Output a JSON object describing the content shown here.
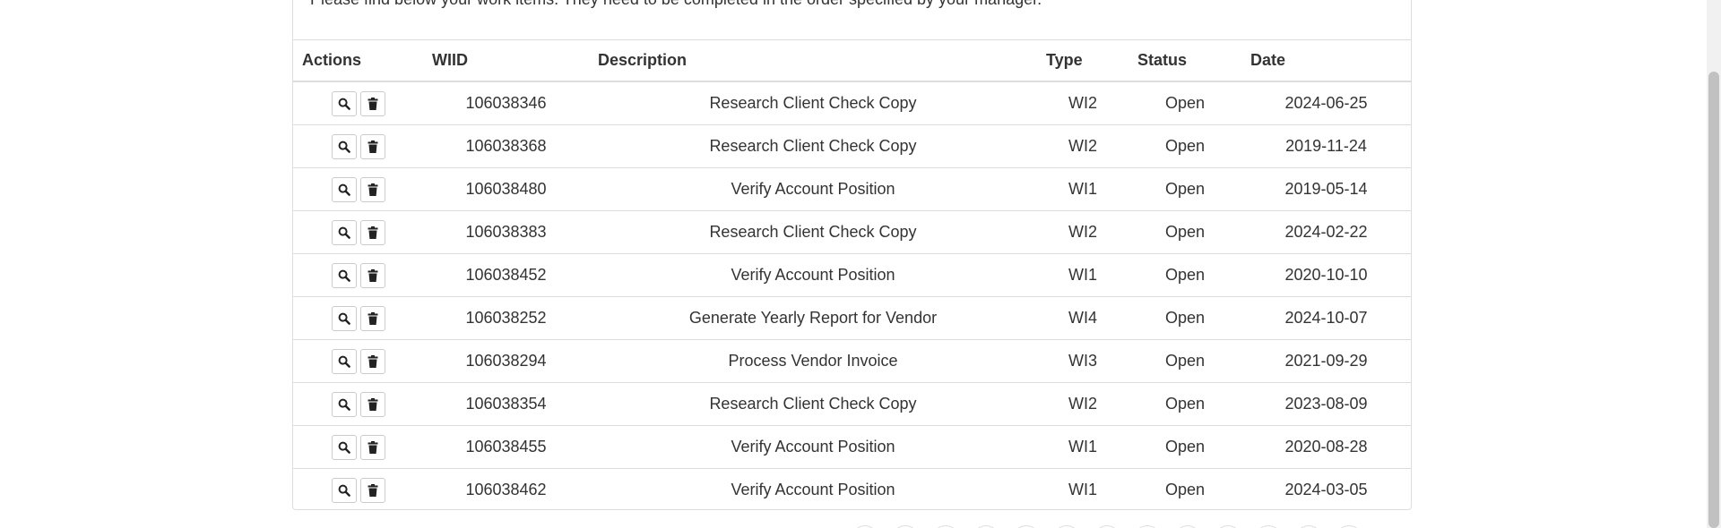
{
  "intro_text": "Please find below your work items. They need to be completed in the order specified by your manager.",
  "table": {
    "headers": {
      "actions": "Actions",
      "wiid": "WIID",
      "description": "Description",
      "type": "Type",
      "status": "Status",
      "date": "Date"
    },
    "rows": [
      {
        "wiid": "106038346",
        "description": "Research Client Check Copy",
        "type": "WI2",
        "status": "Open",
        "date": "2024-06-25"
      },
      {
        "wiid": "106038368",
        "description": "Research Client Check Copy",
        "type": "WI2",
        "status": "Open",
        "date": "2019-11-24"
      },
      {
        "wiid": "106038480",
        "description": "Verify Account Position",
        "type": "WI1",
        "status": "Open",
        "date": "2019-05-14"
      },
      {
        "wiid": "106038383",
        "description": "Research Client Check Copy",
        "type": "WI2",
        "status": "Open",
        "date": "2024-02-22"
      },
      {
        "wiid": "106038452",
        "description": "Verify Account Position",
        "type": "WI1",
        "status": "Open",
        "date": "2020-10-10"
      },
      {
        "wiid": "106038252",
        "description": "Generate Yearly Report for Vendor",
        "type": "WI4",
        "status": "Open",
        "date": "2024-10-07"
      },
      {
        "wiid": "106038294",
        "description": "Process Vendor Invoice",
        "type": "WI3",
        "status": "Open",
        "date": "2021-09-29"
      },
      {
        "wiid": "106038354",
        "description": "Research Client Check Copy",
        "type": "WI2",
        "status": "Open",
        "date": "2023-08-09"
      },
      {
        "wiid": "106038455",
        "description": "Verify Account Position",
        "type": "WI1",
        "status": "Open",
        "date": "2020-08-28"
      },
      {
        "wiid": "106038462",
        "description": "Verify Account Position",
        "type": "WI1",
        "status": "Open",
        "date": "2024-03-05"
      }
    ]
  },
  "icons": {
    "view": "search-icon",
    "delete": "trash-icon"
  }
}
